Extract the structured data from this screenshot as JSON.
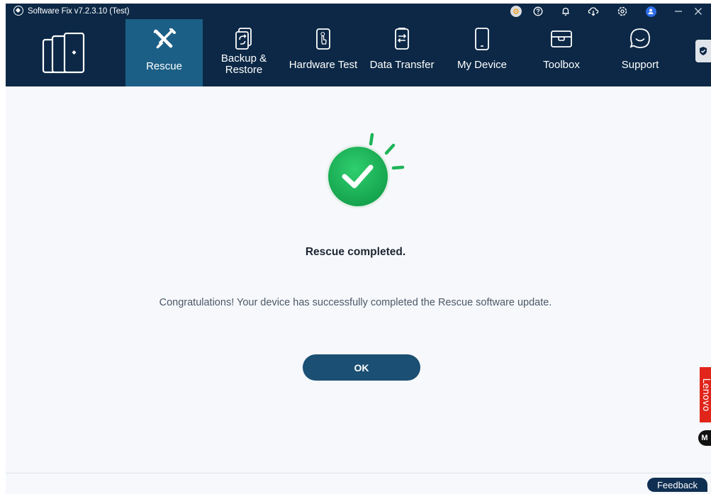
{
  "window": {
    "title": "Software Fix v7.2.3.10 (Test)"
  },
  "titlebar_icons": [
    "disc-icon",
    "help-icon",
    "bell-icon",
    "cloud-download-icon",
    "settings-icon",
    "user-icon",
    "minimize-icon",
    "close-icon"
  ],
  "nav": {
    "items": [
      {
        "label": "Rescue",
        "icon": "wrench-screwdriver-icon",
        "active": true
      },
      {
        "label": "Backup &\nRestore",
        "icon": "backup-restore-icon",
        "active": false
      },
      {
        "label": "Hardware Test",
        "icon": "phone-touch-icon",
        "active": false
      },
      {
        "label": "Data Transfer",
        "icon": "transfer-icon",
        "active": false
      },
      {
        "label": "My Device",
        "icon": "phone-icon",
        "active": false
      },
      {
        "label": "Toolbox",
        "icon": "toolbox-icon",
        "active": false
      },
      {
        "label": "Support",
        "icon": "chat-bubble-icon",
        "active": false
      }
    ]
  },
  "result": {
    "title": "Rescue completed.",
    "message": "Congratulations! Your device has successfully completed the Rescue software update.",
    "ok_label": "OK"
  },
  "brand": {
    "lenovo_text": "Lenovo",
    "motorola_glyph": "M"
  },
  "footer": {
    "feedback_label": "Feedback"
  },
  "colors": {
    "navbar": "#0c2846",
    "active_tab": "#1c5f86",
    "ok_button": "#1b4f73",
    "success_green": "#16a34a",
    "lenovo_red": "#e1251b"
  }
}
